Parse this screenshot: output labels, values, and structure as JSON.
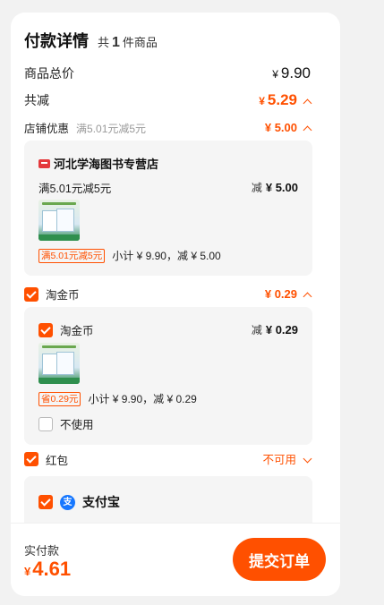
{
  "header": {
    "title": "付款详情",
    "count_prefix": "共",
    "count": "1",
    "count_suffix": "件商品"
  },
  "summary": {
    "total_label": "商品总价",
    "currency": "¥",
    "total_value": "9.90",
    "discount_label": "共减",
    "discount_value": "5.29"
  },
  "shop_discount": {
    "label": "店铺优惠",
    "rule": "满5.01元减5元",
    "value": "5.00",
    "shop_name": "河北学海图书专营店",
    "line_rule": "满5.01元减5元",
    "minus_label": "减",
    "minus_value": "5.00",
    "tag": "满5.01元减5元",
    "subtotal": "小计 ¥ 9.90，减 ¥ 5.00"
  },
  "taojinbi": {
    "label": "淘金币",
    "value": "0.29",
    "inner_label": "淘金币",
    "minus_label": "减",
    "minus_value": "0.29",
    "tag": "省0.29元",
    "subtotal": "小计 ¥ 9.90，减 ¥ 0.29",
    "not_use": "不使用"
  },
  "hongbao": {
    "label": "红包",
    "status": "不可用"
  },
  "alipay": {
    "icon_char": "支",
    "name": "支付宝"
  },
  "footer": {
    "pay_label": "实付款",
    "currency": "¥",
    "pay_value": "4.61",
    "submit_label": "提交订单"
  },
  "colors": {
    "accent": "#ff5000",
    "alipay": "#1677ff"
  }
}
